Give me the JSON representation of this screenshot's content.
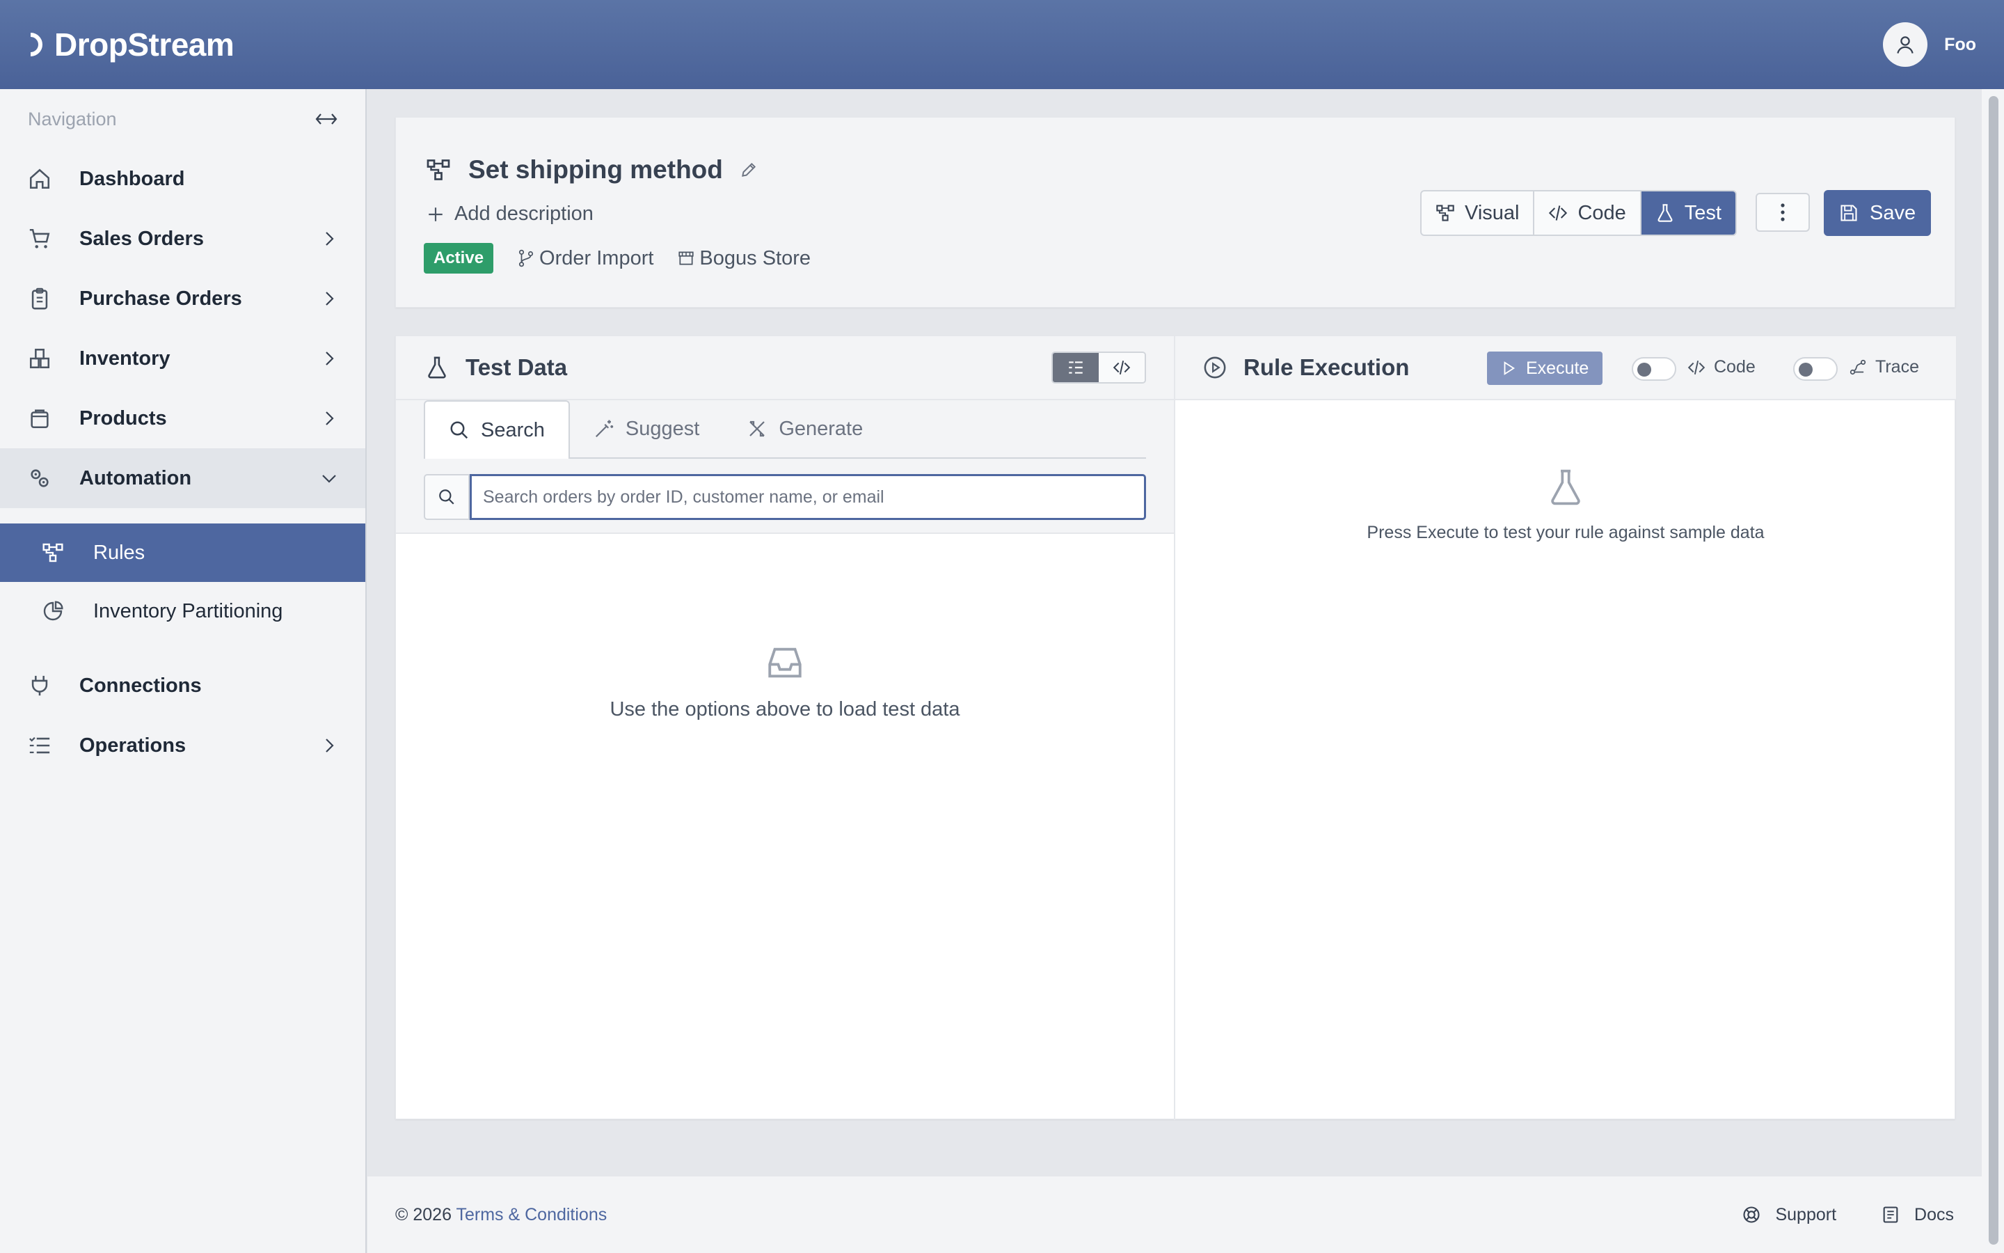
{
  "brand": {
    "name": "DropStream"
  },
  "user": {
    "name": "Foo"
  },
  "sidebar": {
    "heading": "Navigation",
    "items": [
      {
        "label": "Dashboard",
        "icon": "home-icon"
      },
      {
        "label": "Sales Orders",
        "icon": "cart-icon"
      },
      {
        "label": "Purchase Orders",
        "icon": "clipboard-icon"
      },
      {
        "label": "Inventory",
        "icon": "boxes-icon"
      },
      {
        "label": "Products",
        "icon": "bag-icon"
      },
      {
        "label": "Automation",
        "icon": "gears-icon",
        "expanded": true
      },
      {
        "label": "Connections",
        "icon": "plug-icon"
      },
      {
        "label": "Operations",
        "icon": "list-icon"
      }
    ],
    "sub_items": [
      {
        "label": "Rules",
        "icon": "flow-icon",
        "selected": true
      },
      {
        "label": "Inventory Partitioning",
        "icon": "pie-chart-icon"
      }
    ]
  },
  "rule": {
    "title": "Set shipping method",
    "add_description": "Add description",
    "status": "Active",
    "trigger": "Order Import",
    "store": "Bogus Store",
    "status_color": "#2e9d6a"
  },
  "toolbar": {
    "modes": [
      "Visual",
      "Code",
      "Test"
    ],
    "active_mode": "Test",
    "save_label": "Save"
  },
  "test_data": {
    "title": "Test Data",
    "tabs": [
      "Search",
      "Suggest",
      "Generate"
    ],
    "active_tab": "Search",
    "search_placeholder": "Search orders by order ID, customer name, or email",
    "empty_message": "Use the options above to load test data"
  },
  "rule_execution": {
    "title": "Rule Execution",
    "execute_label": "Execute",
    "code_toggle_label": "Code",
    "trace_toggle_label": "Trace",
    "empty_message": "Press Execute to test your rule against sample data"
  },
  "footer": {
    "copyright": "© 2026",
    "terms": "Terms & Conditions",
    "support": "Support",
    "docs": "Docs"
  },
  "colors": {
    "accent": "#4e67a0",
    "header": "#526b9f"
  }
}
